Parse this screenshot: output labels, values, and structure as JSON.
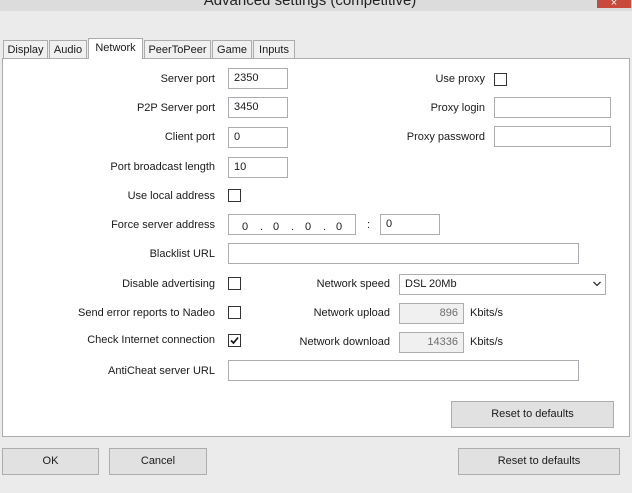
{
  "window": {
    "title": "Advanced settings (competitive)",
    "close_glyph": "×"
  },
  "tabs": [
    {
      "label": "Display",
      "active": false
    },
    {
      "label": "Audio",
      "active": false
    },
    {
      "label": "Network",
      "active": true
    },
    {
      "label": "PeerToPeer",
      "active": false
    },
    {
      "label": "Game",
      "active": false
    },
    {
      "label": "Inputs",
      "active": false
    }
  ],
  "network": {
    "server_port": {
      "label": "Server port",
      "value": "2350"
    },
    "p2p_server_port": {
      "label": "P2P Server port",
      "value": "3450"
    },
    "client_port": {
      "label": "Client port",
      "value": "0"
    },
    "port_broadcast_length": {
      "label": "Port broadcast length",
      "value": "10"
    },
    "use_local_address": {
      "label": "Use local address",
      "checked": false
    },
    "force_server_address": {
      "label": "Force server address",
      "ip": [
        "0",
        "0",
        "0",
        "0"
      ],
      "dot": ".",
      "separator": ":",
      "port": "0"
    },
    "blacklist_url": {
      "label": "Blacklist URL",
      "value": ""
    },
    "disable_advertising": {
      "label": "Disable advertising",
      "checked": false
    },
    "send_error_reports": {
      "label": "Send error reports to Nadeo",
      "checked": false
    },
    "check_internet": {
      "label": "Check Internet connection",
      "checked": true
    },
    "anticheat_url": {
      "label": "AntiCheat server URL",
      "value": ""
    },
    "use_proxy": {
      "label": "Use proxy",
      "checked": false
    },
    "proxy_login": {
      "label": "Proxy login",
      "value": ""
    },
    "proxy_password": {
      "label": "Proxy password",
      "value": ""
    },
    "network_speed": {
      "label": "Network speed",
      "value": "DSL 20Mb"
    },
    "network_upload": {
      "label": "Network upload",
      "value": "896",
      "unit": "Kbits/s"
    },
    "network_download": {
      "label": "Network download",
      "value": "14336",
      "unit": "Kbits/s"
    },
    "reset_label": "Reset to defaults"
  },
  "footer": {
    "ok": "OK",
    "cancel": "Cancel",
    "reset": "Reset to defaults"
  }
}
